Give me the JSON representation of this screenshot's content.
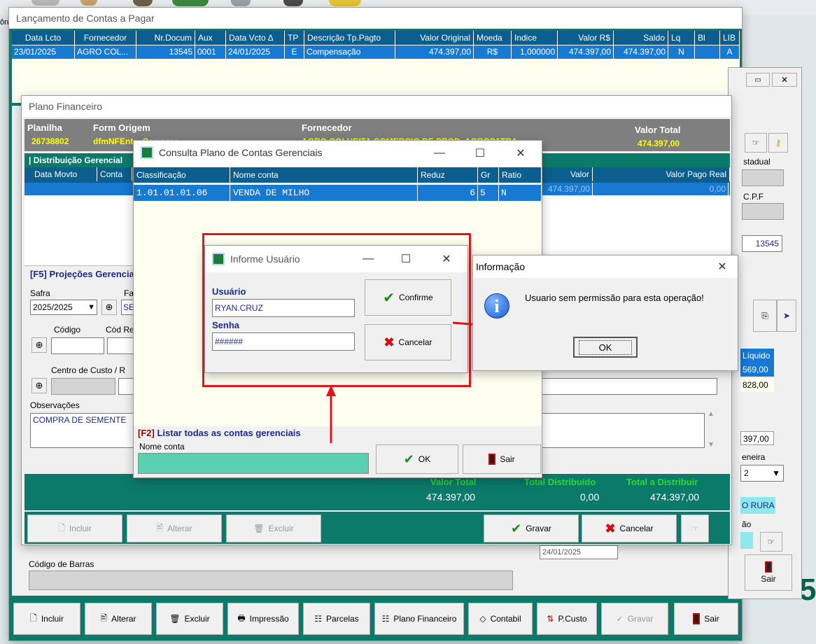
{
  "desktop": {
    "partial_label": "ôni",
    "big_digit": "5("
  },
  "main_window": {
    "title": "Lançamento de Contas a Pagar",
    "columns": [
      "Data Lcto",
      "Fornecedor",
      "Nr.Docum",
      "Aux",
      "Data Vcto ∆",
      "TP",
      "Descrição Tp.Pagto",
      "Valor Original",
      "Moeda",
      "Indice",
      "Valor R$",
      "Saldo",
      "Lq",
      "Bl",
      "LIB"
    ],
    "row": [
      "23/01/2025",
      "AGRO COL...",
      "13545",
      "0001",
      "24/01/2025",
      "E",
      "Compensação",
      "474.397,00",
      "R$",
      "1,000000",
      "474.397,00",
      "474.397,00",
      "N",
      "",
      "A"
    ],
    "bottom_buttons": [
      "Incluir",
      "Alterar",
      "Excluir",
      "Impressão",
      "Parcelas",
      "Plano Financeiro",
      "Contabil",
      "P.Custo",
      "Gravar",
      "Sair"
    ],
    "right_panel": {
      "label_estadual": "stadual",
      "label_cpf": "C.P.F",
      "doc_number": "13545",
      "liquido_header": "Líquido",
      "liquido_values": [
        "569,00",
        "828,00"
      ],
      "total_partial": "397,00",
      "label_financeira": "eneira",
      "select_value": "2",
      "rural_text": "O RURA",
      "label_ao": "ão",
      "sair_label": "Sair"
    },
    "codigo_barras_label": "Código de Barras"
  },
  "plano_window": {
    "title": "Plano Financeiro",
    "header": {
      "planilha_label": "Planilha",
      "planilha_value": "26738802",
      "form_origem_label": "Form Origem",
      "form_origem_value": "dfmNFEnt... Compras",
      "fornecedor_label": "Fornecedor",
      "fornecedor_value": "AGRO COLHEITA COMERCIO DE PROD. AGROPATRA",
      "valor_total_label": "Valor Total",
      "valor_total_value": "474.397,00"
    },
    "distrib_title": "| Distribuição Gerencial",
    "distrib_columns": [
      "Data Movto",
      "Conta",
      "Valor",
      "Valor Pago Real"
    ],
    "distrib_row_partial": {
      "valor": "474.397,00",
      "pago": "0,00"
    },
    "proj_title": "[F5] Projeções Gerenciais",
    "safra_label": "Safra",
    "safra_value": "2025/2025",
    "fa_label": "Fa",
    "se_value": "SE",
    "codigo_label": "Código",
    "cod_re_label": "Cód Re",
    "centro_label": "Centro de Custo / R",
    "obs_label": "Observações",
    "obs_value": "COMPRA DE SEMENTE",
    "totals": {
      "valor_total_label": "Valor Total",
      "valor_total": "474.397,00",
      "distrib_label": "Total Distribuído",
      "distrib": "0,00",
      "adistrib_label": "Total a Distribuir",
      "adistrib": "474.397,00"
    },
    "buttons": [
      "Incluir",
      "Alterar",
      "Excluir",
      "Gravar",
      "Cancelar"
    ],
    "date_partial": "24/01/2025"
  },
  "consulta_window": {
    "title": "Consulta Plano de Contas Gerenciais",
    "columns": [
      "Classificação",
      "Nome conta",
      "Reduz",
      "Gr",
      "Ratio"
    ],
    "row": [
      "1.01.01.01.06",
      "VENDA DE MILHO",
      "6",
      "5",
      "N"
    ],
    "f2_prefix": "[F2]",
    "f2_text": " Listar todas as contas gerenciais",
    "nome_conta_label": "Nome conta",
    "ok_label": "OK",
    "sair_label": "Sair"
  },
  "usuario_window": {
    "title": "Informe Usuário",
    "usuario_label": "Usuário",
    "usuario_value": "RYAN.CRUZ",
    "senha_label": "Senha",
    "senha_value": "######",
    "confirme_label": "Confirme",
    "cancelar_label": "Cancelar"
  },
  "info_window": {
    "title": "Informação",
    "message": "Usuario sem permissão para esta operação!",
    "ok_label": "OK"
  },
  "colors": {
    "grid_header": "#0b5e8e",
    "grid_selection": "#1679d2",
    "teal_dark": "#0c7a6b",
    "annotation_red": "#e8121c",
    "distrib_title": "#1a2a8a"
  }
}
